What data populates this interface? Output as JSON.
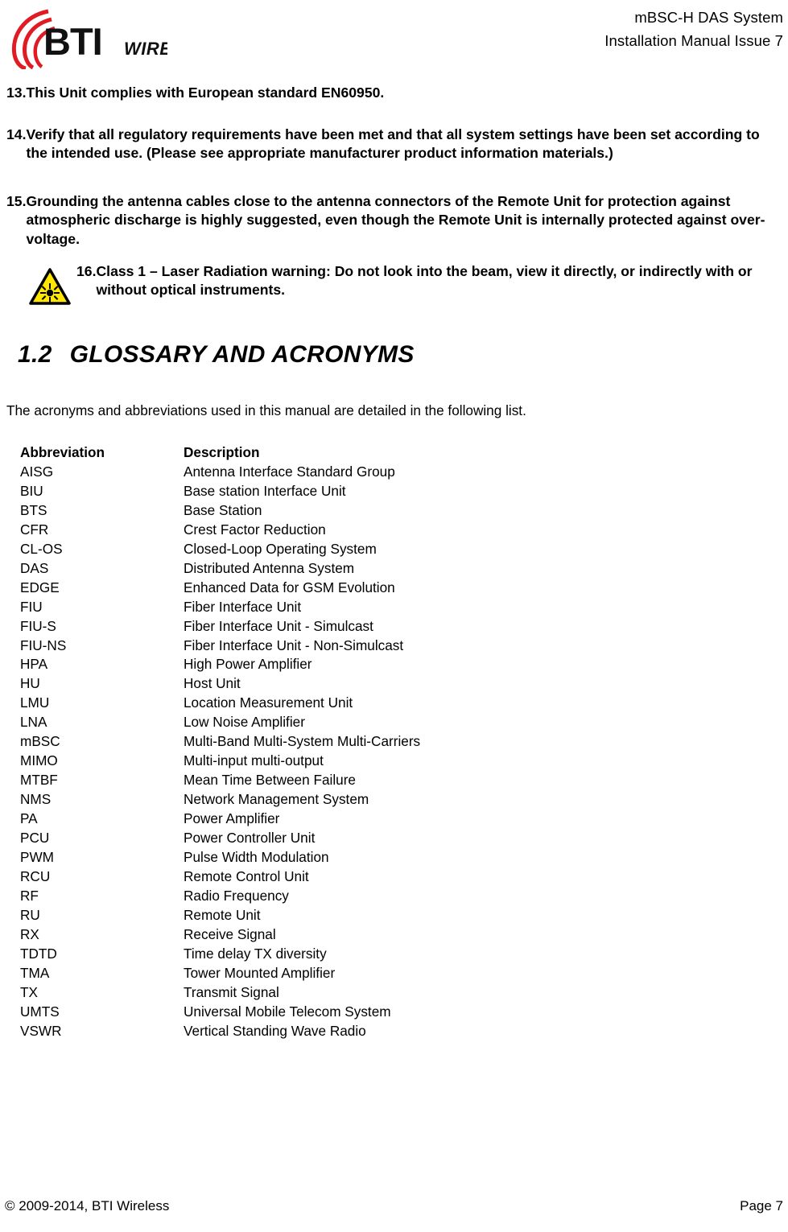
{
  "header": {
    "logo_text": "BTI",
    "logo_subtext": "WIRELESS",
    "logo_color": "#E01B24",
    "title_line1": "mBSC-H DAS System",
    "title_line2": "Installation Manual Issue 7"
  },
  "items": [
    {
      "number": "13.",
      "text": "This Unit complies with European standard EN60950."
    },
    {
      "number": "14.",
      "text": "Verify that all regulatory requirements have been met and that all system settings have been set according to the intended use. (Please see appropriate manufacturer product information materials.)"
    },
    {
      "number": "15.",
      "text": "Grounding the antenna cables close to the antenna connectors of the Remote Unit for protection against atmospheric discharge is highly suggested, even though the Remote Unit is internally protected against over-voltage."
    },
    {
      "number": "16.",
      "text": "Class 1 – Laser Radiation warning:   Do not look into the beam, view it directly, or indirectly with or without optical instruments.",
      "icon": "laser-radiation-warning-icon",
      "icon_fill": "#FFE600",
      "icon_stroke": "#000000"
    }
  ],
  "section": {
    "number": "1.2",
    "title": "GLOSSARY AND ACRONYMS",
    "intro": "The acronyms and abbreviations used in this manual are detailed in the following list."
  },
  "glossary": {
    "headers": [
      "Abbreviation",
      "Description"
    ],
    "rows": [
      [
        "AISG",
        "Antenna Interface Standard Group"
      ],
      [
        "BIU",
        "Base station Interface Unit"
      ],
      [
        "BTS",
        "Base Station"
      ],
      [
        "CFR",
        "Crest Factor Reduction"
      ],
      [
        "CL-OS",
        "Closed-Loop Operating System"
      ],
      [
        "DAS",
        "Distributed Antenna System"
      ],
      [
        "EDGE",
        "Enhanced Data for GSM Evolution"
      ],
      [
        "FIU",
        "Fiber Interface Unit"
      ],
      [
        "FIU-S",
        "Fiber Interface Unit - Simulcast"
      ],
      [
        "FIU-NS",
        "Fiber Interface Unit - Non-Simulcast"
      ],
      [
        "HPA",
        "High Power Amplifier"
      ],
      [
        "HU",
        "Host Unit"
      ],
      [
        "LMU",
        "Location Measurement Unit"
      ],
      [
        "LNA",
        "Low Noise Amplifier"
      ],
      [
        "mBSC",
        "Multi-Band Multi-System Multi-Carriers"
      ],
      [
        "MIMO",
        "Multi-input multi-output"
      ],
      [
        "MTBF",
        "Mean Time Between Failure"
      ],
      [
        "NMS",
        "Network Management System"
      ],
      [
        "PA",
        "Power Amplifier"
      ],
      [
        "PCU",
        "Power Controller Unit"
      ],
      [
        "PWM",
        "Pulse Width Modulation"
      ],
      [
        "RCU",
        "Remote Control Unit"
      ],
      [
        "RF",
        "Radio Frequency"
      ],
      [
        "RU",
        "Remote Unit"
      ],
      [
        "RX",
        "Receive Signal"
      ],
      [
        "TDTD",
        "Time delay TX diversity"
      ],
      [
        "TMA",
        "Tower Mounted Amplifier"
      ],
      [
        "TX",
        "Transmit Signal"
      ],
      [
        "UMTS",
        "Universal Mobile Telecom System"
      ],
      [
        "VSWR",
        "Vertical Standing Wave Radio"
      ]
    ]
  },
  "footer": {
    "copyright": "© 2009-2014, BTI Wireless",
    "page": "Page 7"
  }
}
